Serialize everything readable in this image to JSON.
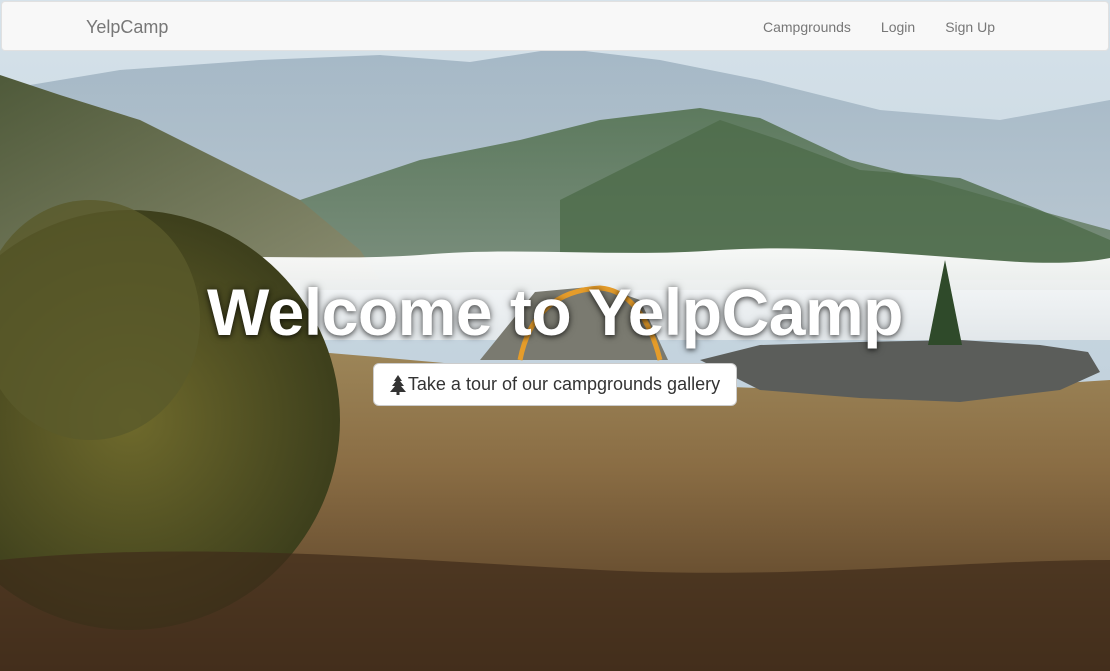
{
  "navbar": {
    "brand": "YelpCamp",
    "links": [
      {
        "label": "Campgrounds"
      },
      {
        "label": "Login"
      },
      {
        "label": "Sign Up"
      }
    ]
  },
  "landing": {
    "title": "Welcome to YelpCamp",
    "tour_button": {
      "icon": "tree-icon",
      "label": "Take a tour of our campgrounds gallery"
    }
  },
  "background": {
    "description_icon": "mountain-camp-photo"
  },
  "colors": {
    "navbar_bg": "#f8f8f8",
    "nav_text": "#777777",
    "title_text": "#ffffff",
    "button_bg": "#ffffff",
    "button_text": "#333333"
  }
}
